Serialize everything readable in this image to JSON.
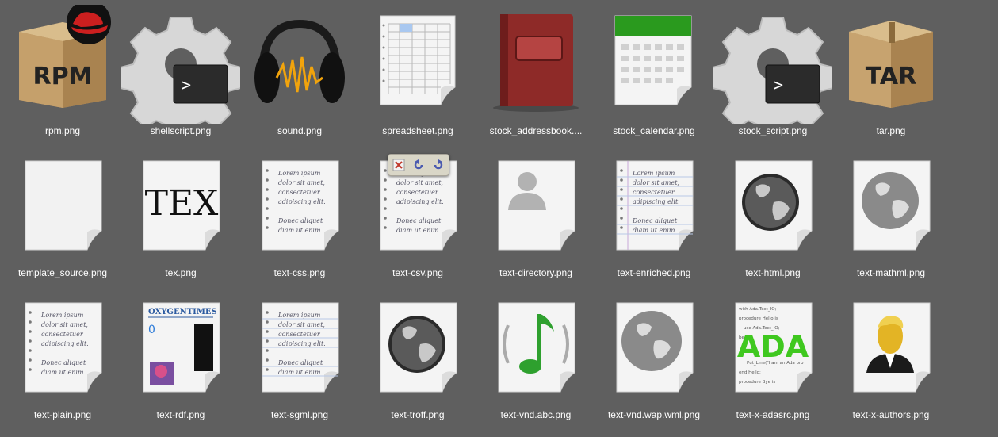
{
  "icons": [
    {
      "name": "rpm.png",
      "label": "RPM"
    },
    {
      "name": "shellscript.png"
    },
    {
      "name": "sound.png"
    },
    {
      "name": "spreadsheet.png"
    },
    {
      "name": "stock_addressbook...."
    },
    {
      "name": "stock_calendar.png"
    },
    {
      "name": "stock_script.png"
    },
    {
      "name": "tar.png",
      "label": "TAR"
    },
    {
      "name": "template_source.png"
    },
    {
      "name": "tex.png",
      "label": "TEX"
    },
    {
      "name": "text-css.png"
    },
    {
      "name": "text-csv.png"
    },
    {
      "name": "text-directory.png"
    },
    {
      "name": "text-enriched.png"
    },
    {
      "name": "text-html.png"
    },
    {
      "name": "text-mathml.png"
    },
    {
      "name": "text-plain.png"
    },
    {
      "name": "text-rdf.png",
      "masthead": "OXYGENTIMES",
      "mark": "0"
    },
    {
      "name": "text-sgml.png"
    },
    {
      "name": "text-troff.png"
    },
    {
      "name": "text-vnd.abc.png"
    },
    {
      "name": "text-vnd.wap.wml.png"
    },
    {
      "name": "text-x-adasrc.png",
      "big": "ADA",
      "code": [
        "with Ada.Text_IO;",
        "procedure Hello is",
        "use Ada.Text_IO;",
        "begin",
        "Put_Line(\"I am an Ada pro",
        "end Hello;",
        "procedure Bye is"
      ]
    },
    {
      "name": "text-x-authors.png"
    }
  ],
  "lorem": [
    "Lorem ipsum",
    "dolor sit amet,",
    "consectetuer",
    "adipiscing elit.",
    "Donec aliquet",
    "diam ut enim"
  ],
  "shell_prompt": ">_",
  "colors": {
    "background": "#5f5f5f",
    "caption": "#ffffff",
    "ada_green": "#3fc81f",
    "book_red": "#8e2a28",
    "calendar_green": "#2a9a1e"
  }
}
